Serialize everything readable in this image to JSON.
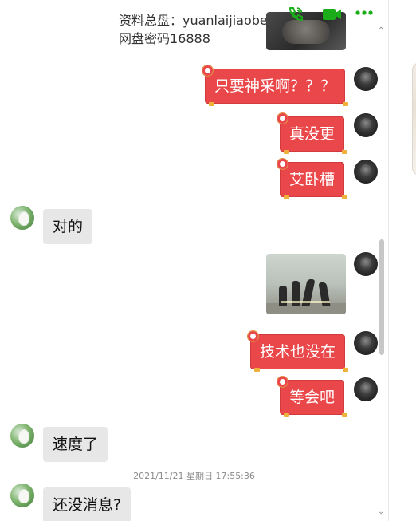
{
  "header": {
    "resource_line": "资料总盘：yuanlaijiaoben.uupan.net",
    "password_line": "网盘密码16888",
    "icons": [
      "phone-icon",
      "video-call-icon",
      "more-icon"
    ],
    "accent_green": "#1aad19"
  },
  "messages": {
    "m1": "只要神采啊？？？",
    "m2": "真没更",
    "m3": "艾卧槽",
    "m4": "对的",
    "m5": "技术也没在",
    "m6": "等会吧",
    "m7": "速度了",
    "m8": "还没消息?"
  },
  "timestamp": "2021/11/21 星期日 17:55:36",
  "colors": {
    "red_bubble": "#e9474a",
    "friend_bubble": "#e7e7e7",
    "timestamp_text": "#8a8a8a"
  }
}
